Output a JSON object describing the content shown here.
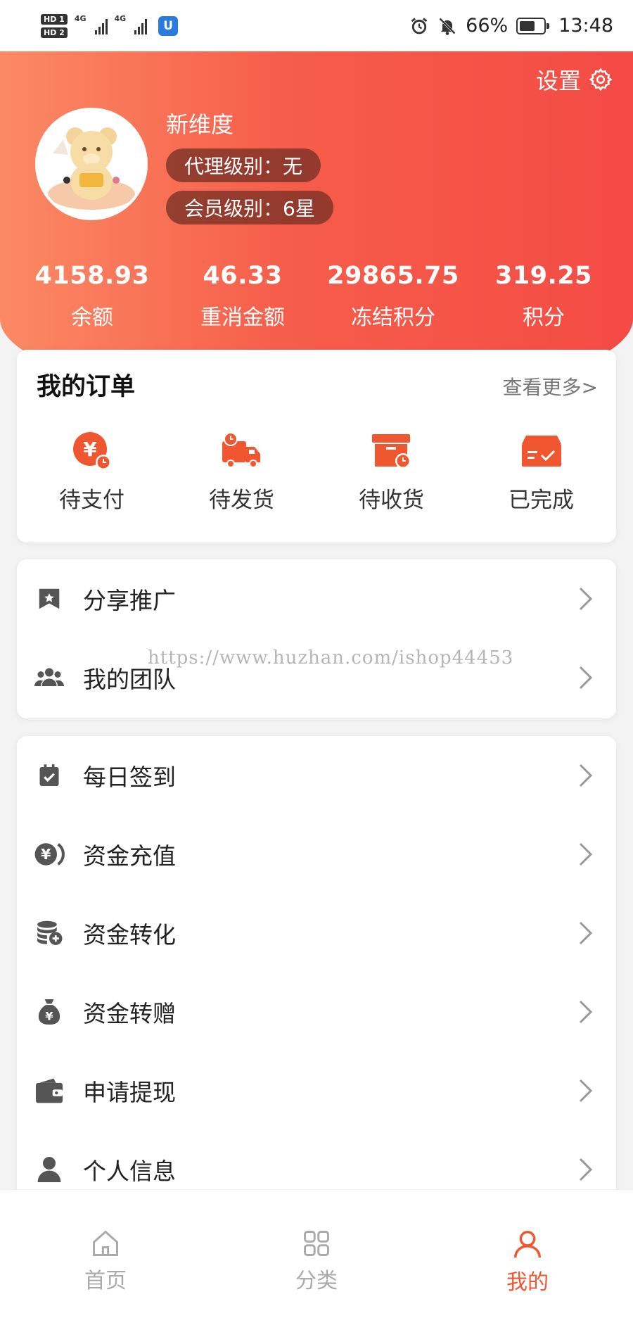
{
  "status_bar": {
    "hd1": "HD 1",
    "hd2": "HD 2",
    "net1": "4G",
    "net2": "4G",
    "app_badge": "U",
    "battery_text": "66%",
    "battery_level": 0.66,
    "time": "13:48"
  },
  "header": {
    "settings_label": "设置",
    "nickname": "新维度",
    "agent_level": "代理级别：无",
    "member_level": "会员级别：6星",
    "stats": [
      {
        "value": "4158.93",
        "label": "余额"
      },
      {
        "value": "46.33",
        "label": "重消金额"
      },
      {
        "value": "29865.75",
        "label": "冻结积分"
      },
      {
        "value": "319.25",
        "label": "积分"
      }
    ]
  },
  "orders": {
    "title": "我的订单",
    "more": "查看更多>",
    "items": [
      {
        "label": "待支付",
        "icon": "yuan-clock-icon"
      },
      {
        "label": "待发货",
        "icon": "truck-icon"
      },
      {
        "label": "待收货",
        "icon": "box-clock-icon"
      },
      {
        "label": "已完成",
        "icon": "box-check-icon"
      }
    ]
  },
  "menu_group_1": [
    {
      "label": "分享推广",
      "icon": "share-flag-icon"
    },
    {
      "label": "我的团队",
      "icon": "team-icon"
    }
  ],
  "menu_group_2": [
    {
      "label": "每日签到",
      "icon": "calendar-check-icon"
    },
    {
      "label": "资金充值",
      "icon": "yuan-coin-icon"
    },
    {
      "label": "资金转化",
      "icon": "coin-stack-icon"
    },
    {
      "label": "资金转赠",
      "icon": "money-bag-icon"
    },
    {
      "label": "申请提现",
      "icon": "wallet-icon"
    },
    {
      "label": "个人信息",
      "icon": "person-icon"
    }
  ],
  "watermark": "https://www.huzhan.com/ishop44453",
  "tabbar": [
    {
      "label": "首页",
      "icon": "home-icon"
    },
    {
      "label": "分类",
      "icon": "grid-icon"
    },
    {
      "label": "我的",
      "icon": "user-icon",
      "active": true
    }
  ],
  "colors": {
    "accent": "#f0562f",
    "header_start": "#fb8a64",
    "header_end": "#f44b44",
    "icon_gray": "#555555"
  }
}
